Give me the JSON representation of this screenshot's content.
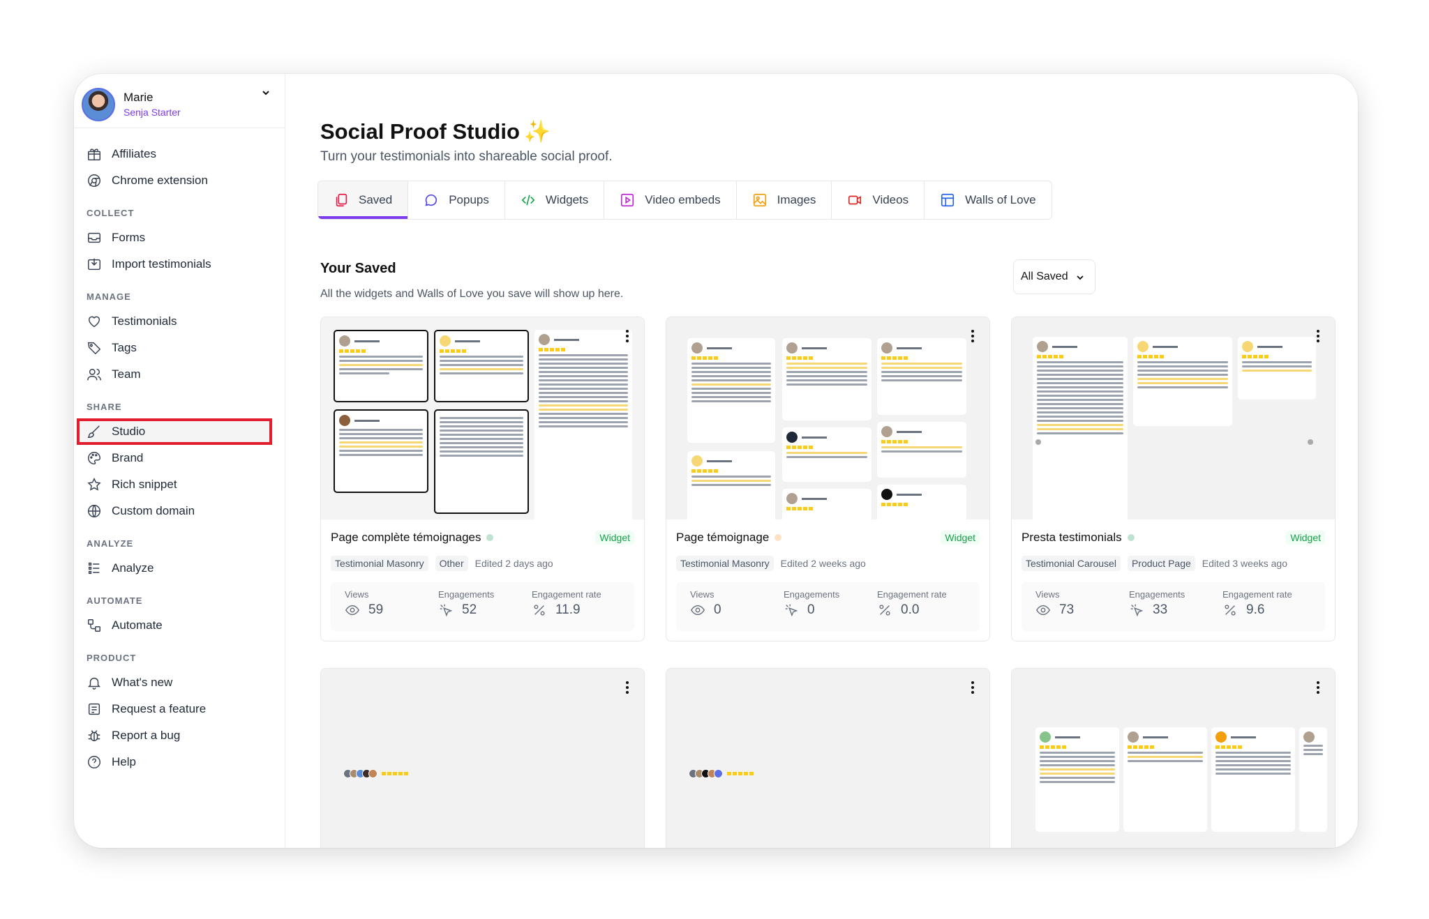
{
  "user": {
    "name": "Marie",
    "plan": "Senja Starter"
  },
  "sidebar": {
    "top_items": [
      {
        "label": "Affiliates",
        "icon": "gift-icon"
      },
      {
        "label": "Chrome extension",
        "icon": "chrome-icon"
      }
    ],
    "sections": [
      {
        "label": "COLLECT",
        "items": [
          {
            "label": "Forms",
            "icon": "inbox-icon"
          },
          {
            "label": "Import testimonials",
            "icon": "import-icon"
          }
        ]
      },
      {
        "label": "MANAGE",
        "items": [
          {
            "label": "Testimonials",
            "icon": "heart-icon"
          },
          {
            "label": "Tags",
            "icon": "tag-icon"
          },
          {
            "label": "Team",
            "icon": "team-icon"
          }
        ]
      },
      {
        "label": "SHARE",
        "items": [
          {
            "label": "Studio",
            "icon": "brush-icon",
            "active": true
          },
          {
            "label": "Brand",
            "icon": "palette-icon"
          },
          {
            "label": "Rich snippet",
            "icon": "star-icon"
          },
          {
            "label": "Custom domain",
            "icon": "globe-icon"
          }
        ]
      },
      {
        "label": "ANALYZE",
        "items": [
          {
            "label": "Analyze",
            "icon": "analyze-icon"
          }
        ]
      },
      {
        "label": "AUTOMATE",
        "items": [
          {
            "label": "Automate",
            "icon": "automate-icon"
          }
        ]
      },
      {
        "label": "PRODUCT",
        "items": [
          {
            "label": "What's new",
            "icon": "bell-icon"
          },
          {
            "label": "Request a feature",
            "icon": "request-icon"
          },
          {
            "label": "Report a bug",
            "icon": "bug-icon"
          },
          {
            "label": "Help",
            "icon": "help-icon"
          }
        ]
      }
    ]
  },
  "header": {
    "title": "Social Proof Studio",
    "sparkle": "✨",
    "subtitle": "Turn your testimonials into shareable social proof."
  },
  "tabs": [
    {
      "label": "Saved",
      "icon": "copy-icon",
      "color": "#e11d48",
      "active": true
    },
    {
      "label": "Popups",
      "icon": "chat-icon",
      "color": "#4f46e5"
    },
    {
      "label": "Widgets",
      "icon": "code-icon",
      "color": "#16a34a"
    },
    {
      "label": "Video embeds",
      "icon": "play-icon",
      "color": "#c026d3"
    },
    {
      "label": "Images",
      "icon": "image-icon",
      "color": "#f59e0b"
    },
    {
      "label": "Videos",
      "icon": "video-icon",
      "color": "#dc2626"
    },
    {
      "label": "Walls of Love",
      "icon": "grid-icon",
      "color": "#2563eb"
    }
  ],
  "saved": {
    "title": "Your Saved",
    "subtitle": "All the widgets and Walls of Love you save will show up here.",
    "filter": "All Saved"
  },
  "cards": [
    {
      "name": "Page complète témoignages",
      "status_color": "#bfe3d0",
      "type": "Widget",
      "tags": [
        "Testimonial Masonry",
        "Other"
      ],
      "edited": "Edited 2 days ago",
      "stats": {
        "views_label": "Views",
        "views": "59",
        "eng_label": "Engagements",
        "engagements": "52",
        "rate_label": "Engagement rate",
        "rate": "11.9"
      }
    },
    {
      "name": "Page témoignage",
      "status_color": "#fde3c4",
      "type": "Widget",
      "tags": [
        "Testimonial Masonry"
      ],
      "edited": "Edited 2 weeks ago",
      "stats": {
        "views_label": "Views",
        "views": "0",
        "eng_label": "Engagements",
        "engagements": "0",
        "rate_label": "Engagement rate",
        "rate": "0.0"
      }
    },
    {
      "name": "Presta testimonials",
      "status_color": "#bfe3d0",
      "type": "Widget",
      "tags": [
        "Testimonial Carousel",
        "Product Page"
      ],
      "edited": "Edited 3 weeks ago",
      "stats": {
        "views_label": "Views",
        "views": "73",
        "eng_label": "Engagements",
        "engagements": "33",
        "rate_label": "Engagement rate",
        "rate": "9.6"
      }
    }
  ]
}
